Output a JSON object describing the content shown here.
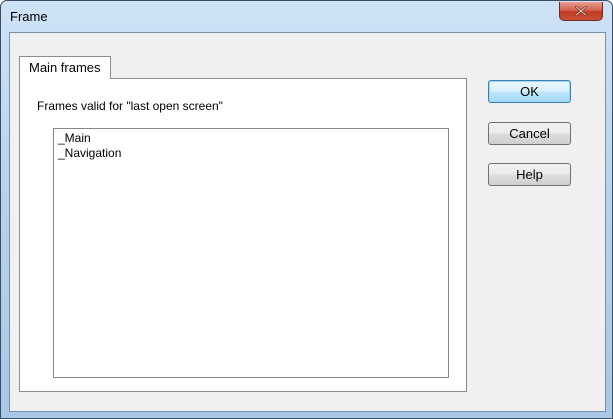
{
  "window": {
    "title": "Frame",
    "close_icon": "close-icon"
  },
  "tabs": [
    {
      "label": "Main frames",
      "selected": true
    }
  ],
  "panel": {
    "label": "Frames valid for \"last open screen\"",
    "items": [
      "_Main",
      "_Navigation"
    ]
  },
  "buttons": {
    "ok": "OK",
    "cancel": "Cancel",
    "help": "Help"
  },
  "colors": {
    "close_button": "#c23a22",
    "default_button_border": "#3c7fb1",
    "dialog_background": "#f0f0f0"
  }
}
